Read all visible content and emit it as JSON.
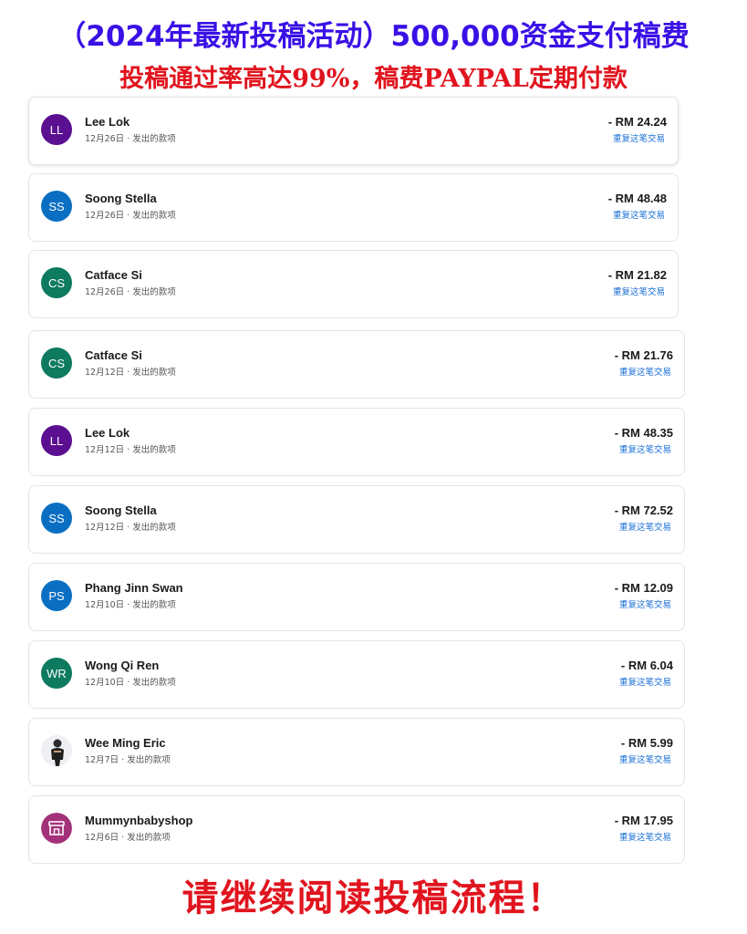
{
  "banner": {
    "headline": "（2024年最新投稿活动）500,000资金支付稿费",
    "subline": "投稿通过率高达99%，稿费PAYPAL定期付款",
    "footer": "请继续阅读投稿流程！"
  },
  "colors": {
    "headline": "#3a10e6",
    "highlight_red": "#e0141e",
    "link_blue": "#1a6fd6",
    "avatar_purple": "#5b0f91",
    "avatar_blue": "#0a6fc2",
    "avatar_green": "#0e7a5f",
    "avatar_shop": "#a3327a"
  },
  "transactions": [
    {
      "initials": "LL",
      "avatar": "purple",
      "name": "Lee Lok",
      "date": "12月26日",
      "type": "发出的款项",
      "amount": "- RM 24.24",
      "action": "重复这笔交易"
    },
    {
      "initials": "SS",
      "avatar": "blue",
      "name": "Soong Stella",
      "date": "12月26日",
      "type": "发出的款项",
      "amount": "- RM 48.48",
      "action": "重复这笔交易"
    },
    {
      "initials": "CS",
      "avatar": "green",
      "name": "Catface Si",
      "date": "12月26日",
      "type": "发出的款项",
      "amount": "- RM 21.82",
      "action": "重复这笔交易"
    },
    {
      "initials": "CS",
      "avatar": "green",
      "name": "Catface Si",
      "date": "12月12日",
      "type": "发出的款项",
      "amount": "- RM 21.76",
      "action": "重复这笔交易"
    },
    {
      "initials": "LL",
      "avatar": "purple",
      "name": "Lee Lok",
      "date": "12月12日",
      "type": "发出的款项",
      "amount": "- RM 48.35",
      "action": "重复这笔交易"
    },
    {
      "initials": "SS",
      "avatar": "blue",
      "name": "Soong Stella",
      "date": "12月12日",
      "type": "发出的款项",
      "amount": "- RM 72.52",
      "action": "重复这笔交易"
    },
    {
      "initials": "PS",
      "avatar": "blue",
      "name": "Phang Jinn Swan",
      "date": "12月10日",
      "type": "发出的款项",
      "amount": "- RM 12.09",
      "action": "重复这笔交易"
    },
    {
      "initials": "WR",
      "avatar": "green",
      "name": "Wong Qi Ren",
      "date": "12月10日",
      "type": "发出的款项",
      "amount": "- RM 6.04",
      "action": "重复这笔交易"
    },
    {
      "initials": "",
      "avatar": "photo",
      "avatar_icon": "person-photo-icon",
      "name": "Wee Ming Eric",
      "date": "12月7日",
      "type": "发出的款项",
      "amount": "- RM 5.99",
      "action": "重复这笔交易"
    },
    {
      "initials": "",
      "avatar": "shop",
      "avatar_icon": "shop-icon",
      "name": "Mummynbabyshop",
      "date": "12月6日",
      "type": "发出的款项",
      "amount": "- RM 17.95",
      "action": "重复这笔交易"
    }
  ]
}
